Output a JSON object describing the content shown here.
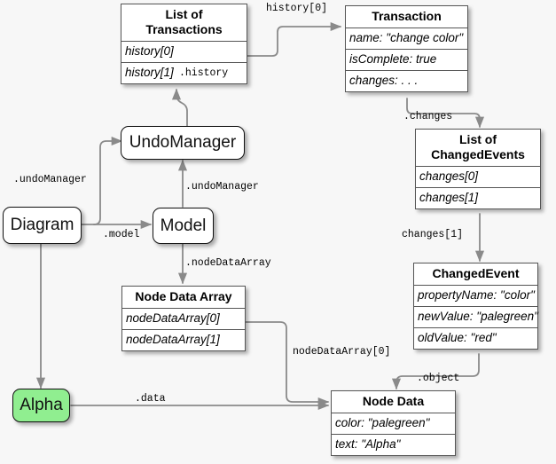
{
  "diagram": {
    "title": "GoJS model / UndoManager object reference diagram",
    "background_color": "#f7f7f7",
    "highlight_color": "#90ee90",
    "stroke_color": "#555555"
  },
  "nodes": {
    "list_of_transactions": {
      "header": "List of\nTransactions",
      "rows": [
        "history[0]",
        "history[1]"
      ]
    },
    "transaction": {
      "header": "Transaction",
      "rows": [
        "name: \"change color\"",
        "isComplete: true",
        "changes: . . ."
      ]
    },
    "list_of_changed_events": {
      "header": "List of\nChangedEvents",
      "rows": [
        "changes[0]",
        "changes[1]"
      ]
    },
    "changed_event": {
      "header": "ChangedEvent",
      "rows": [
        "propertyName: \"color\"",
        "newValue: \"palegreen\"",
        "oldValue: \"red\""
      ]
    },
    "node_data_array": {
      "header": "Node Data Array",
      "rows": [
        "nodeDataArray[0]",
        "nodeDataArray[1]"
      ]
    },
    "node_data": {
      "header": "Node Data",
      "rows": [
        "color: \"palegreen\"",
        "text: \"Alpha\""
      ]
    },
    "undo_manager": {
      "label": "UndoManager"
    },
    "diagram_node": {
      "label": "Diagram"
    },
    "model": {
      "label": "Model"
    },
    "alpha": {
      "label": "Alpha"
    }
  },
  "link_labels": {
    "history_0": "history[0]",
    "history": ".history",
    "changes": ".changes",
    "changes_1": "changes[1]",
    "undo_manager_from_diagram": ".undoManager",
    "undo_manager_from_model": ".undoManager",
    "model": ".model",
    "node_data_array": ".nodeDataArray",
    "node_data_array_0": "nodeDataArray[0]",
    "object": ".object",
    "data": ".data"
  }
}
